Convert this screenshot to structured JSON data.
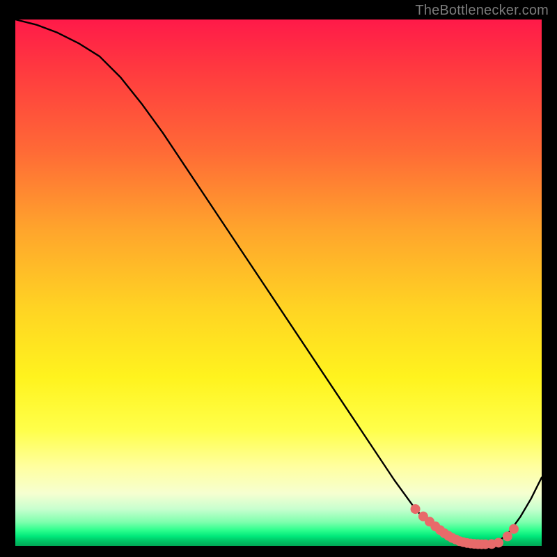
{
  "attribution": "TheBottlenecker.com",
  "chart_data": {
    "type": "line",
    "title": "",
    "xlabel": "",
    "ylabel": "",
    "xlim": [
      0,
      100
    ],
    "ylim": [
      0,
      100
    ],
    "x": [
      0,
      4,
      8,
      12,
      16,
      20,
      24,
      28,
      32,
      36,
      40,
      44,
      48,
      52,
      56,
      60,
      64,
      68,
      72,
      76,
      78,
      80,
      82,
      84,
      86,
      88,
      90,
      92,
      94,
      96,
      98,
      100
    ],
    "values": [
      100,
      99,
      97.5,
      95.5,
      93,
      89,
      84,
      78.5,
      72.5,
      66.5,
      60.5,
      54.5,
      48.5,
      42.5,
      36.5,
      30.5,
      24.5,
      18.5,
      12.5,
      7,
      4.8,
      3,
      1.8,
      1,
      0.5,
      0.3,
      0.3,
      1,
      2.8,
      5.6,
      9,
      13
    ],
    "markers": {
      "x": [
        76,
        77.5,
        78.7,
        79.8,
        80.7,
        81.5,
        82.3,
        83,
        83.7,
        84.4,
        85.1,
        85.8,
        86.5,
        87.2,
        87.9,
        88.6,
        89.3,
        90.5,
        91.8,
        93.5,
        94.7
      ],
      "y": [
        7,
        5.6,
        4.6,
        3.7,
        3,
        2.4,
        1.9,
        1.5,
        1.2,
        0.9,
        0.7,
        0.55,
        0.45,
        0.38,
        0.33,
        0.3,
        0.3,
        0.35,
        0.6,
        1.8,
        3.2
      ],
      "color": "#e86a6a",
      "radius": 7
    },
    "line_color": "#000000",
    "line_width": 2.4
  },
  "colors": {
    "page_bg": "#000000",
    "attribution": "#7b7b7b"
  }
}
